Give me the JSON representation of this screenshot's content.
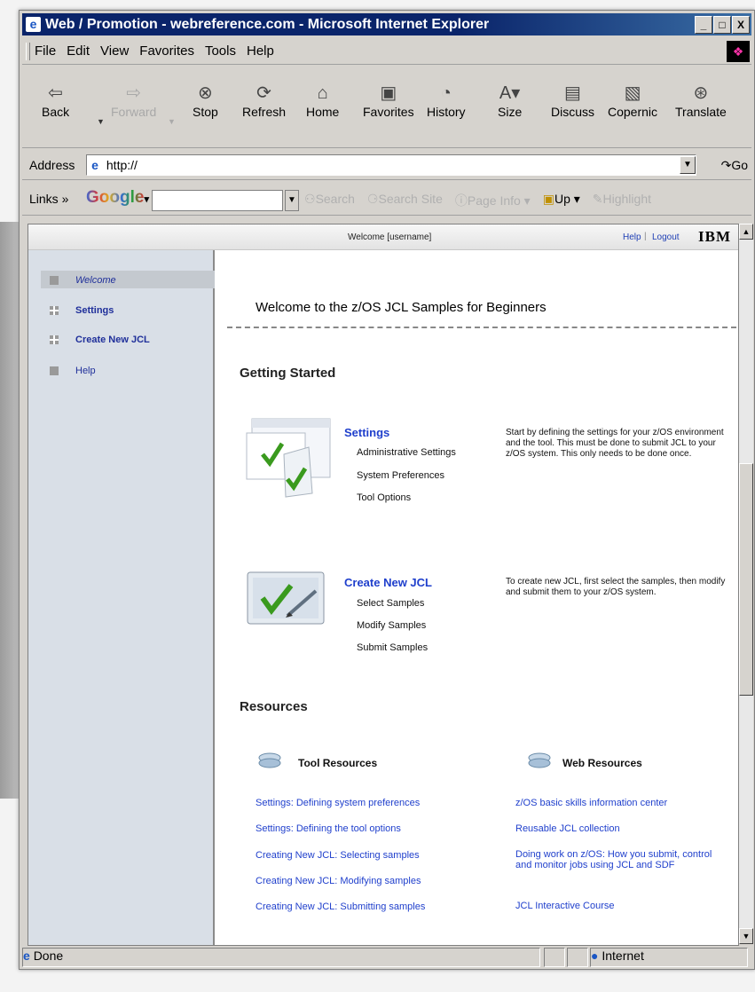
{
  "window": {
    "title": "Web / Promotion - webreference.com - Microsoft Internet Explorer",
    "buttons": [
      "_",
      "□",
      "X"
    ]
  },
  "menu": [
    "File",
    "Edit",
    "View",
    "Favorites",
    "Tools",
    "Help"
  ],
  "toolbar": [
    {
      "label": "Back",
      "icon": "back-arrow-icon",
      "enabled": true
    },
    {
      "label": "Forward",
      "icon": "forward-arrow-icon",
      "enabled": false
    },
    {
      "label": "Stop",
      "icon": "stop-icon",
      "enabled": true
    },
    {
      "label": "Refresh",
      "icon": "refresh-icon",
      "enabled": true
    },
    {
      "label": "Home",
      "icon": "home-icon",
      "enabled": true
    },
    {
      "label": "Favorites",
      "icon": "favorites-icon",
      "enabled": true
    },
    {
      "label": "History",
      "icon": "history-icon",
      "enabled": true
    },
    {
      "label": "Size",
      "icon": "size-icon",
      "enabled": true
    },
    {
      "label": "Discuss",
      "icon": "discuss-icon",
      "enabled": true
    },
    {
      "label": "Copernic",
      "icon": "copernic-icon",
      "enabled": true
    },
    {
      "label": "Translate",
      "icon": "translate-icon",
      "enabled": true
    }
  ],
  "address": {
    "label": "Address",
    "value": "http://",
    "go": "Go"
  },
  "links_bar": {
    "label": "Links",
    "google": "Google",
    "search": "Search",
    "search_site": "Search Site",
    "page_info": "Page Info",
    "up": "Up",
    "highlight": "Highlight"
  },
  "page": {
    "top": {
      "welcome": "Welcome [username]",
      "help": "Help",
      "logout": "Logout",
      "brand": "IBM"
    },
    "nav": [
      "Welcome",
      "Settings",
      "Create New JCL",
      "Help"
    ],
    "headline": "Welcome to the z/OS JCL Samples for Beginners",
    "getting_started": "Getting Started",
    "settings": {
      "title": "Settings",
      "items": [
        "Administrative Settings",
        "System Preferences",
        "Tool Options"
      ],
      "description": "Start by defining the settings for your z/OS environment and the tool. This must be done to submit JCL to your z/OS system. This only needs to be done once."
    },
    "create": {
      "title": "Create New JCL",
      "items": [
        "Select Samples",
        "Modify Samples",
        "Submit Samples"
      ],
      "description": "To create new JCL, first select the samples, then modify and submit them to your z/OS system."
    },
    "resources": "Resources",
    "tool_resources": {
      "title": "Tool Resources",
      "links": [
        "Settings: Defining system preferences",
        "Settings: Defining the tool options",
        "Creating New JCL: Selecting samples",
        "Creating New JCL: Modifying samples",
        "Creating New JCL: Submitting samples"
      ]
    },
    "web_resources": {
      "title": "Web Resources",
      "links": [
        "z/OS basic skills information center",
        "Reusable JCL collection",
        "Doing work on z/OS: How you submit, control and monitor jobs using JCL and SDF",
        "JCL Interactive Course"
      ]
    }
  },
  "status": {
    "text": "Done",
    "zone": "Internet"
  }
}
